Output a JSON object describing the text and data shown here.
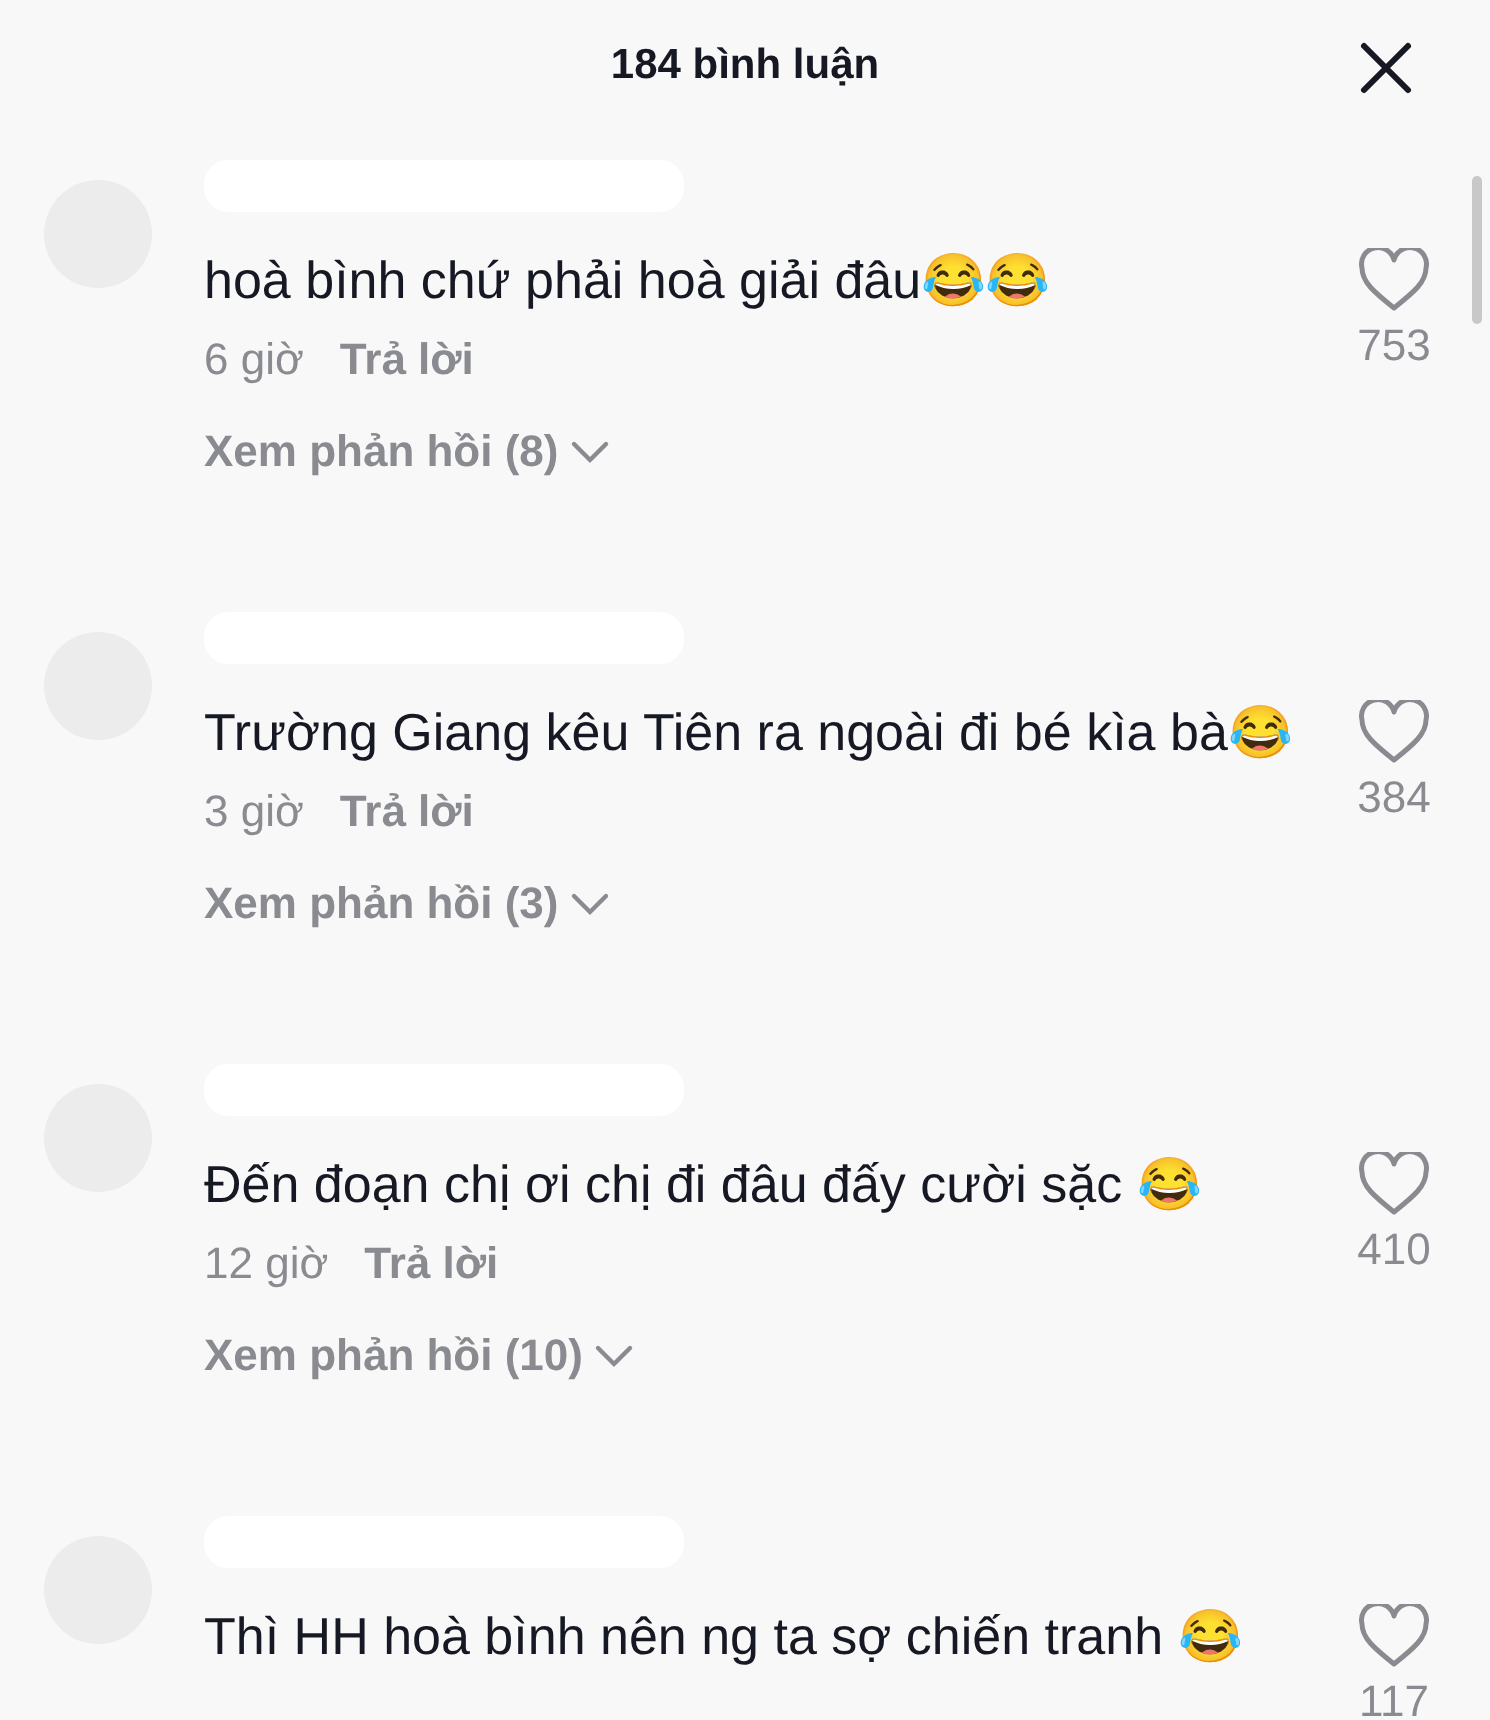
{
  "header": {
    "title": "184 bình luận"
  },
  "comments": [
    {
      "text": "hoà bình chứ phải hoà giải đâu😂😂",
      "time": "6 giờ",
      "reply": "Trả lời",
      "view_replies": "Xem phản hồi (8)",
      "likes": "753"
    },
    {
      "text": "Trường Giang kêu Tiên ra ngoài đi bé kìa bà😂",
      "time": "3 giờ",
      "reply": "Trả lời",
      "view_replies": "Xem phản hồi (3)",
      "likes": "384"
    },
    {
      "text": "Đến đoạn chị ơi chị đi đâu đấy cười sặc 😂",
      "time": "12 giờ",
      "reply": "Trả lời",
      "view_replies": "Xem phản hồi (10)",
      "likes": "410"
    },
    {
      "text": "Thì HH hoà bình nên ng ta sợ chiến tranh 😂",
      "likes": "117"
    }
  ]
}
